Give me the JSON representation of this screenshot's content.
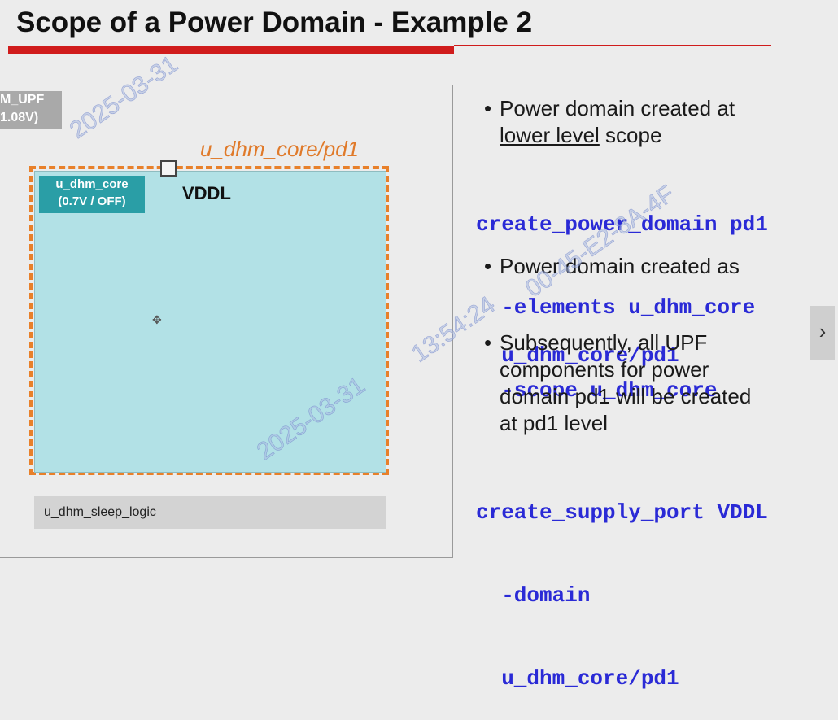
{
  "slide": {
    "title": "Scope of a Power Domain - Example 2",
    "diagram": {
      "top_label_line1": "M_UPF",
      "top_label_line2": "1.08V)",
      "domain_label": "u_dhm_core/pd1",
      "core_label_line1": "u_dhm_core",
      "core_label_line2": "(0.7V / OFF)",
      "port_label": "VDDL",
      "sleep_logic_label": "u_dhm_sleep_logic"
    },
    "bullets": [
      {
        "lines": [
          "Power domain created at"
        ],
        "underlined": "lower level",
        "after_underline": " scope"
      },
      {
        "lines": [
          "Power domain created as"
        ]
      },
      {
        "lines": [
          "Subsequently, all UPF",
          "components for power",
          "domain pd1 will be created",
          "at pd1 level"
        ]
      }
    ],
    "code_blocks": [
      [
        "create_power_domain pd1",
        "  -elements u_dhm_core",
        "  -scope u_dhm_core"
      ],
      [
        "  u_dhm_core/pd1"
      ],
      [
        "create_supply_port VDDL",
        "  -domain",
        "  u_dhm_core/pd1"
      ]
    ],
    "colors": {
      "accent_red": "#d01c1c",
      "code_blue": "#2a2ad6",
      "domain_orange": "#e8802a",
      "core_fill": "#b2e1e6"
    }
  },
  "viewer": {
    "next_label": "›"
  },
  "watermarks": [
    "2025-03-31 13:54:24",
    "2025-03-31",
    "13:54:24",
    "00-45-E2-8A-4F"
  ]
}
